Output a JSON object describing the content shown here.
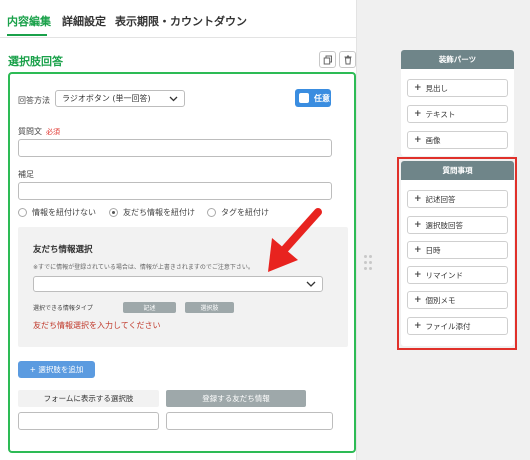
{
  "tabs": [
    {
      "label": "内容編集",
      "active": true
    },
    {
      "label": "詳細設定",
      "active": false
    },
    {
      "label": "表示期限・カウントダウン",
      "active": false
    }
  ],
  "section": {
    "title": "選択肢回答"
  },
  "form": {
    "answer_method_label": "回答方法",
    "answer_method_value": "ラジオボタン (単一回答)",
    "toggle_label": "任意",
    "question_label": "質問文",
    "required_badge": "必須",
    "supplement_label": "補足",
    "radio_options": [
      {
        "label": "情報を紐付けない",
        "selected": false
      },
      {
        "label": "友だち情報を紐付け",
        "selected": true
      },
      {
        "label": "タグを紐付け",
        "selected": false
      }
    ],
    "friend_info": {
      "title": "友だち情報選択",
      "note": "※すでに情報が登録されている場合は、情報が上書きされますのでご注意下さい。",
      "selectable_type_label": "選択できる情報タイプ",
      "types": [
        "記述",
        "選択肢"
      ],
      "error": "友だち情報選択を入力してください"
    },
    "add_choice_button": "+ 選択肢を追加",
    "columns": [
      "フォームに表示する選択肢",
      "登録する友だち情報"
    ]
  },
  "parts_panel": {
    "title": "装飾パーツ",
    "items": [
      "見出し",
      "テキスト",
      "画像"
    ]
  },
  "question_panel": {
    "title": "質問事項",
    "items": [
      "記述回答",
      "選択肢回答",
      "日時",
      "リマインド",
      "個別メモ",
      "ファイル添付"
    ]
  },
  "colors": {
    "accent_green": "#1aa14a",
    "panel_header": "#6f8589",
    "highlight_red": "#e0302a",
    "annotation_arrow": "#e8231f",
    "toggle_blue": "#3a8de0"
  }
}
